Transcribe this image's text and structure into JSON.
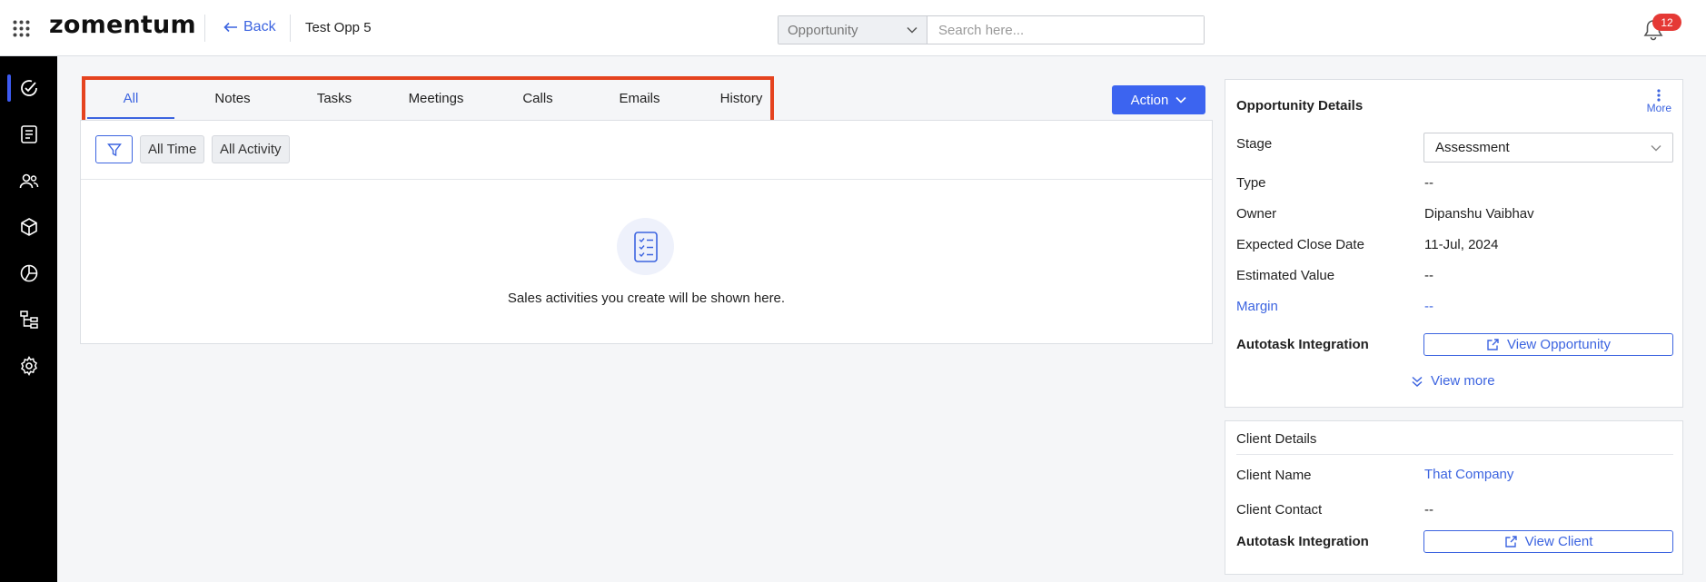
{
  "header": {
    "logo": "zomentum",
    "back_label": "Back",
    "breadcrumb": "Test Opp 5",
    "search_scope": "Opportunity",
    "search_placeholder": "Search here...",
    "notification_count": "12"
  },
  "sidebar": {
    "items": [
      {
        "icon": "activity-icon",
        "active": true
      },
      {
        "icon": "document-icon"
      },
      {
        "icon": "users-icon"
      },
      {
        "icon": "box-icon"
      },
      {
        "icon": "pie-chart-icon"
      },
      {
        "icon": "hierarchy-icon"
      },
      {
        "icon": "gear-icon"
      }
    ]
  },
  "activity": {
    "tabs": [
      {
        "label": "All",
        "active": true
      },
      {
        "label": "Notes"
      },
      {
        "label": "Tasks"
      },
      {
        "label": "Meetings"
      },
      {
        "label": "Calls"
      },
      {
        "label": "Emails"
      },
      {
        "label": "History"
      }
    ],
    "action_label": "Action",
    "filters": {
      "time": "All Time",
      "activity": "All Activity"
    },
    "empty_message": "Sales activities you create will be shown here."
  },
  "opportunity_details": {
    "title": "Opportunity Details",
    "more_label": "More",
    "stage_label": "Stage",
    "stage_value": "Assessment",
    "type_label": "Type",
    "type_value": "--",
    "owner_label": "Owner",
    "owner_value": "Dipanshu Vaibhav",
    "close_date_label": "Expected Close Date",
    "close_date_value": "11-Jul, 2024",
    "estimated_value_label": "Estimated Value",
    "estimated_value_value": "--",
    "margin_label": "Margin",
    "margin_value": "--",
    "integration_label": "Autotask Integration",
    "integration_button": "View Opportunity",
    "view_more_label": "View more"
  },
  "client_details": {
    "title": "Client Details",
    "name_label": "Client Name",
    "name_value": "That Company",
    "contact_label": "Client Contact",
    "contact_value": "--",
    "integration_label": "Autotask Integration",
    "integration_button": "View Client"
  },
  "colors": {
    "accent": "#3c64e0",
    "highlight": "#e5431f",
    "badge": "#e53935",
    "nav_bg": "#000000"
  }
}
